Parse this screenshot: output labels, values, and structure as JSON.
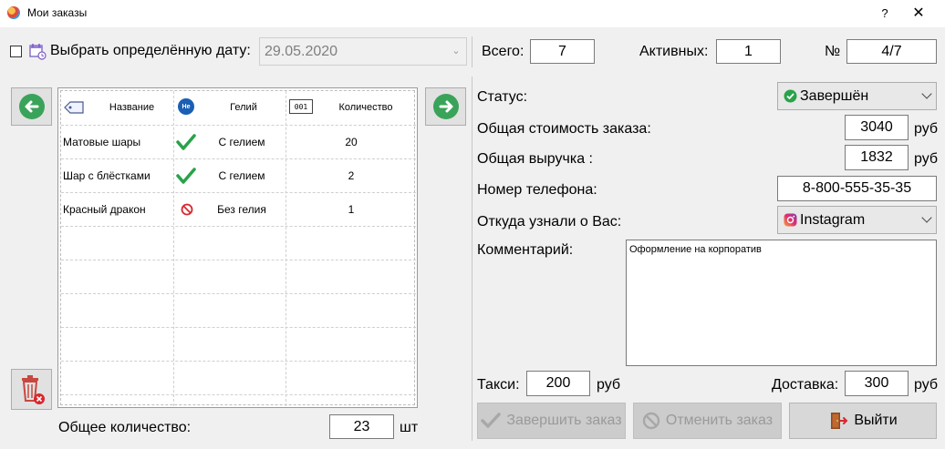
{
  "window": {
    "title": "Мои заказы",
    "help": "?",
    "close": "✕"
  },
  "filter": {
    "checkbox_label": "Выбрать определённую дату:",
    "date_value": "29.05.2020"
  },
  "summary": {
    "total_label": "Всего:",
    "total_value": "7",
    "active_label": "Активных:",
    "active_value": "1",
    "number_label": "№",
    "number_value": "4/7"
  },
  "table": {
    "headers": [
      "Название",
      "Гелий",
      "Количество"
    ],
    "helium_icon_text": "He",
    "rows": [
      {
        "name": "Матовые шары",
        "helium": "С гелием",
        "helium_status": "check",
        "qty": "20"
      },
      {
        "name": "Шар с блёстками",
        "helium": "С гелием",
        "helium_status": "check",
        "qty": "2"
      },
      {
        "name": "Красный дракон",
        "helium": "Без гелия",
        "helium_status": "no",
        "qty": "1"
      }
    ]
  },
  "footer": {
    "total_qty_label": "Общее количество:",
    "total_qty_value": "23",
    "total_qty_unit": "шт"
  },
  "details": {
    "status_label": "Статус:",
    "status_value": "Завершён",
    "total_cost_label": "Общая стоимость заказа:",
    "total_cost_value": "3040",
    "revenue_label": "Общая выручка :",
    "revenue_value": "1832",
    "currency": "руб",
    "phone_label": "Номер телефона:",
    "phone_value": "8-800-555-35-35",
    "source_label": "Откуда узнали о Вас:",
    "source_value": "Instagram",
    "comment_label": "Комментарий:",
    "comment_value": "Оформление на корпоратив",
    "taxi_label": "Такси:",
    "taxi_value": "200",
    "delivery_label": "Доставка:",
    "delivery_value": "300"
  },
  "actions": {
    "complete_label": "Завершить заказ",
    "cancel_label": "Отменить заказ",
    "exit_label": "Выйти"
  },
  "colors": {
    "accent_green": "#2aa24a",
    "arrow_bg": "#3aa35a",
    "ban_red": "#d9272e"
  }
}
